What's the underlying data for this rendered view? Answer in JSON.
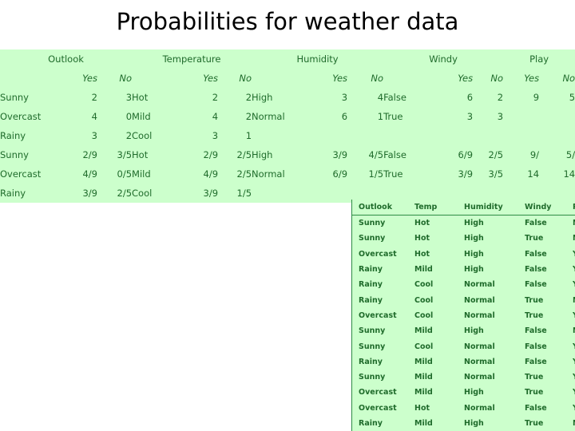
{
  "title": "Probabilities for weather data",
  "colors": {
    "table_background": "#ccffcc",
    "table_text": "#1f6b2b",
    "table_border": "#2e8b45",
    "title_text": "#000000",
    "page_background": "#ffffff"
  },
  "prob_table": {
    "groups": [
      {
        "name": "Outlook"
      },
      {
        "name": "Temperature"
      },
      {
        "name": "Humidity"
      },
      {
        "name": "Windy"
      },
      {
        "name": "Play"
      }
    ],
    "subheaders": {
      "yes": "Yes",
      "no": "No"
    },
    "counts": {
      "outlook": [
        {
          "label": "Sunny",
          "yes": "2",
          "no": "3"
        },
        {
          "label": "Overcast",
          "yes": "4",
          "no": "0"
        },
        {
          "label": "Rainy",
          "yes": "3",
          "no": "2"
        }
      ],
      "temperature": [
        {
          "label": "Hot",
          "yes": "2",
          "no": "2"
        },
        {
          "label": "Mild",
          "yes": "4",
          "no": "2"
        },
        {
          "label": "Cool",
          "yes": "3",
          "no": "1"
        }
      ],
      "humidity": [
        {
          "label": "High",
          "yes": "3",
          "no": "4"
        },
        {
          "label": "Normal",
          "yes": "6",
          "no": "1"
        },
        {
          "label": "",
          "yes": "",
          "no": ""
        }
      ],
      "windy": [
        {
          "label": "False",
          "yes": "6",
          "no": "2"
        },
        {
          "label": "True",
          "yes": "3",
          "no": "3"
        },
        {
          "label": "",
          "yes": "",
          "no": ""
        }
      ],
      "play": [
        {
          "yes": "9",
          "no": "5"
        },
        {
          "yes": "",
          "no": ""
        },
        {
          "yes": "",
          "no": ""
        }
      ]
    },
    "probabilities": {
      "outlook": [
        {
          "label": "Sunny",
          "yes": "2/9",
          "no": "3/5"
        },
        {
          "label": "Overcast",
          "yes": "4/9",
          "no": "0/5"
        },
        {
          "label": "Rainy",
          "yes": "3/9",
          "no": "2/5"
        }
      ],
      "temperature": [
        {
          "label": "Hot",
          "yes": "2/9",
          "no": "2/5"
        },
        {
          "label": "Mild",
          "yes": "4/9",
          "no": "2/5"
        },
        {
          "label": "Cool",
          "yes": "3/9",
          "no": "1/5"
        }
      ],
      "humidity": [
        {
          "label": "High",
          "yes": "3/9",
          "no": "4/5"
        },
        {
          "label": "Normal",
          "yes": "6/9",
          "no": "1/5"
        },
        {
          "label": "",
          "yes": "",
          "no": ""
        }
      ],
      "windy": [
        {
          "label": "False",
          "yes": "6/9",
          "no": "2/5"
        },
        {
          "label": "True",
          "yes": "3/9",
          "no": "3/5"
        },
        {
          "label": "",
          "yes": "",
          "no": ""
        }
      ],
      "play": [
        {
          "yes": "9/",
          "no": "5/"
        },
        {
          "yes": "14",
          "no": "14"
        },
        {
          "yes": "",
          "no": ""
        }
      ]
    }
  },
  "data_table": {
    "headers": {
      "outlook": "Outlook",
      "temp": "Temp",
      "humidity": "Humidity",
      "windy": "Windy",
      "play": "Play"
    },
    "rows": [
      {
        "outlook": "Sunny",
        "temp": "Hot",
        "humidity": "High",
        "windy": "False",
        "play": "No"
      },
      {
        "outlook": "Sunny",
        "temp": "Hot",
        "humidity": "High",
        "windy": "True",
        "play": "No"
      },
      {
        "outlook": "Overcast",
        "temp": "Hot",
        "humidity": "High",
        "windy": "False",
        "play": "Yes"
      },
      {
        "outlook": "Rainy",
        "temp": "Mild",
        "humidity": "High",
        "windy": "False",
        "play": "Yes"
      },
      {
        "outlook": "Rainy",
        "temp": "Cool",
        "humidity": "Normal",
        "windy": "False",
        "play": "Yes"
      },
      {
        "outlook": "Rainy",
        "temp": "Cool",
        "humidity": "Normal",
        "windy": "True",
        "play": "No"
      },
      {
        "outlook": "Overcast",
        "temp": "Cool",
        "humidity": "Normal",
        "windy": "True",
        "play": "Yes"
      },
      {
        "outlook": "Sunny",
        "temp": "Mild",
        "humidity": "High",
        "windy": "False",
        "play": "No"
      },
      {
        "outlook": "Sunny",
        "temp": "Cool",
        "humidity": "Normal",
        "windy": "False",
        "play": "Yes"
      },
      {
        "outlook": "Rainy",
        "temp": "Mild",
        "humidity": "Normal",
        "windy": "False",
        "play": "Yes"
      },
      {
        "outlook": "Sunny",
        "temp": "Mild",
        "humidity": "Normal",
        "windy": "True",
        "play": "Yes"
      },
      {
        "outlook": "Overcast",
        "temp": "Mild",
        "humidity": "High",
        "windy": "True",
        "play": "Yes"
      },
      {
        "outlook": "Overcast",
        "temp": "Hot",
        "humidity": "Normal",
        "windy": "False",
        "play": "Yes"
      },
      {
        "outlook": "Rainy",
        "temp": "Mild",
        "humidity": "High",
        "windy": "True",
        "play": "No"
      }
    ]
  }
}
